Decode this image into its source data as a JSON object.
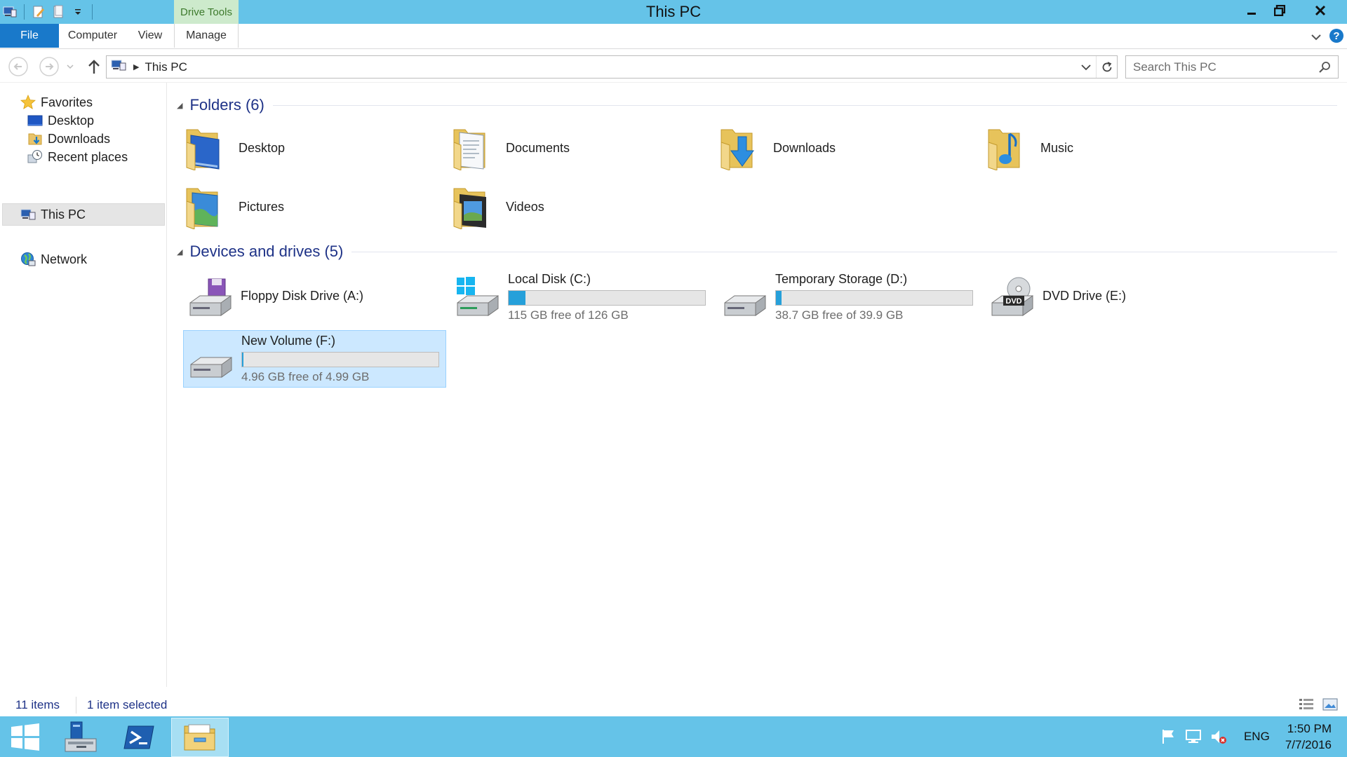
{
  "window": {
    "title": "This PC",
    "contextual_tab": "Drive Tools",
    "accent": "#65c3e8"
  },
  "ribbon": {
    "file": "File",
    "tabs": [
      "Computer",
      "View",
      "Manage"
    ]
  },
  "address": {
    "crumb": "This PC",
    "search_placeholder": "Search This PC"
  },
  "navpane": {
    "favorites": "Favorites",
    "favorites_items": [
      "Desktop",
      "Downloads",
      "Recent places"
    ],
    "this_pc": "This PC",
    "network": "Network"
  },
  "folders": {
    "header": "Folders (6)",
    "items": [
      {
        "name": "Desktop",
        "icon": "desktop-folder-icon"
      },
      {
        "name": "Documents",
        "icon": "documents-folder-icon"
      },
      {
        "name": "Downloads",
        "icon": "downloads-folder-icon"
      },
      {
        "name": "Music",
        "icon": "music-folder-icon"
      },
      {
        "name": "Pictures",
        "icon": "pictures-folder-icon"
      },
      {
        "name": "Videos",
        "icon": "videos-folder-icon"
      }
    ]
  },
  "devices": {
    "header": "Devices and drives (5)",
    "items": [
      {
        "name": "Floppy Disk Drive (A:)",
        "icon": "floppy-drive-icon"
      },
      {
        "name": "Local Disk (C:)",
        "free": "115 GB free of 126 GB",
        "used_fraction": 0.087,
        "icon": "system-drive-icon"
      },
      {
        "name": "Temporary Storage (D:)",
        "free": "38.7 GB free of 39.9 GB",
        "used_fraction": 0.03,
        "icon": "hard-drive-icon"
      },
      {
        "name": "DVD Drive (E:)",
        "icon": "dvd-drive-icon",
        "badge": "DVD"
      },
      {
        "name": "New Volume (F:)",
        "free": "4.96 GB free of 4.99 GB",
        "used_fraction": 0.006,
        "icon": "hard-drive-icon",
        "selected": true
      }
    ]
  },
  "status": {
    "count": "11 items",
    "selection": "1 item selected"
  },
  "taskbar": {
    "items": [
      "start-button",
      "server-manager",
      "powershell",
      "file-explorer"
    ],
    "language": "ENG",
    "time": "1:50 PM",
    "date": "7/7/2016"
  }
}
